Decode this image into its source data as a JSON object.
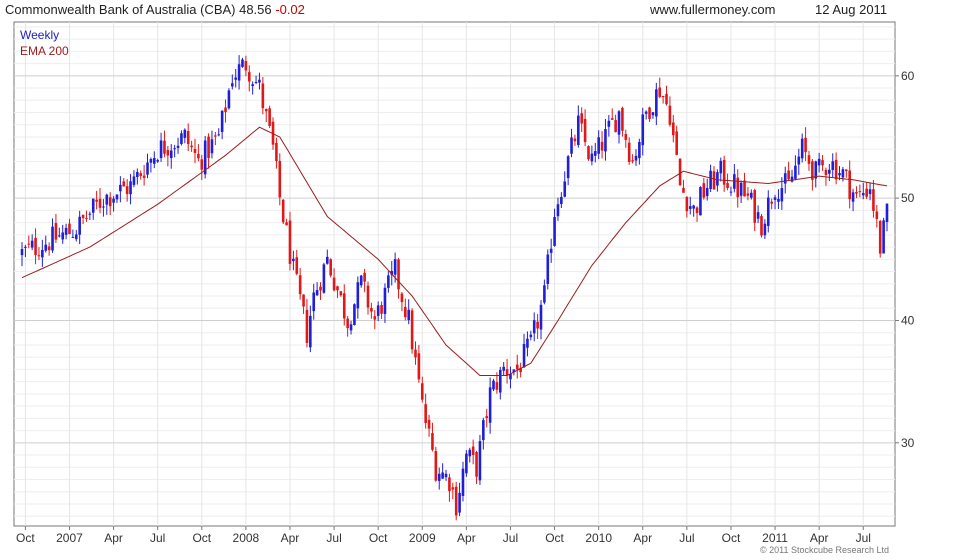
{
  "header": {
    "ticker": "Commonwealth Bank of Australia (CBA) 48.56",
    "change": "-0.02",
    "site": "www.fullermoney.com",
    "date": "12 Aug 2011"
  },
  "footer": {
    "copyright": "© 2011 Stockcube Research Ltd"
  },
  "colors": {
    "up": "#1f1fd6",
    "down": "#e01818",
    "ema": "#9b1c1c",
    "grid": "#d8d8d8",
    "axis": "#666666"
  },
  "chart_data": {
    "type": "candlestick",
    "frequency_label": "Weekly",
    "indicator_label": "EMA 200",
    "x_tick_labels": [
      "Oct",
      "2007",
      "Apr",
      "Jul",
      "Oct",
      "2008",
      "Apr",
      "Jul",
      "Oct",
      "2009",
      "Apr",
      "Jul",
      "Oct",
      "2010",
      "Apr",
      "Jul",
      "Oct",
      "2011",
      "Apr",
      "Jul"
    ],
    "y_ticks": [
      30,
      40,
      50,
      60
    ],
    "ylim": [
      23.2,
      64.4
    ],
    "xlim": [
      0,
      255
    ],
    "grid": true,
    "legend": "top-left",
    "price_anchors": [
      {
        "x": 0,
        "y": 45.5
      },
      {
        "x": 8,
        "y": 46.5
      },
      {
        "x": 16,
        "y": 47.5
      },
      {
        "x": 24,
        "y": 50
      },
      {
        "x": 32,
        "y": 51
      },
      {
        "x": 40,
        "y": 54
      },
      {
        "x": 48,
        "y": 55
      },
      {
        "x": 52,
        "y": 53
      },
      {
        "x": 58,
        "y": 55
      },
      {
        "x": 62,
        "y": 60
      },
      {
        "x": 66,
        "y": 61
      },
      {
        "x": 70,
        "y": 59
      },
      {
        "x": 74,
        "y": 54
      },
      {
        "x": 76,
        "y": 50
      },
      {
        "x": 80,
        "y": 44
      },
      {
        "x": 84,
        "y": 39
      },
      {
        "x": 86,
        "y": 42
      },
      {
        "x": 90,
        "y": 45
      },
      {
        "x": 96,
        "y": 40
      },
      {
        "x": 100,
        "y": 43
      },
      {
        "x": 104,
        "y": 40
      },
      {
        "x": 110,
        "y": 44
      },
      {
        "x": 114,
        "y": 40
      },
      {
        "x": 118,
        "y": 33
      },
      {
        "x": 122,
        "y": 28
      },
      {
        "x": 126,
        "y": 27
      },
      {
        "x": 128,
        "y": 25
      },
      {
        "x": 131,
        "y": 29
      },
      {
        "x": 134,
        "y": 28
      },
      {
        "x": 138,
        "y": 34
      },
      {
        "x": 142,
        "y": 36
      },
      {
        "x": 146,
        "y": 36
      },
      {
        "x": 150,
        "y": 38
      },
      {
        "x": 154,
        "y": 42
      },
      {
        "x": 157,
        "y": 49
      },
      {
        "x": 160,
        "y": 52
      },
      {
        "x": 164,
        "y": 56
      },
      {
        "x": 168,
        "y": 53
      },
      {
        "x": 172,
        "y": 55
      },
      {
        "x": 176,
        "y": 57
      },
      {
        "x": 180,
        "y": 53
      },
      {
        "x": 184,
        "y": 57
      },
      {
        "x": 188,
        "y": 59
      },
      {
        "x": 191,
        "y": 57
      },
      {
        "x": 194,
        "y": 51
      },
      {
        "x": 198,
        "y": 49
      },
      {
        "x": 202,
        "y": 51
      },
      {
        "x": 206,
        "y": 52
      },
      {
        "x": 210,
        "y": 51
      },
      {
        "x": 214,
        "y": 50
      },
      {
        "x": 218,
        "y": 48
      },
      {
        "x": 222,
        "y": 51
      },
      {
        "x": 226,
        "y": 51
      },
      {
        "x": 230,
        "y": 54
      },
      {
        "x": 234,
        "y": 52
      },
      {
        "x": 238,
        "y": 53
      },
      {
        "x": 242,
        "y": 52
      },
      {
        "x": 246,
        "y": 50
      },
      {
        "x": 250,
        "y": 51
      },
      {
        "x": 253,
        "y": 46
      },
      {
        "x": 255,
        "y": 48.6
      }
    ],
    "ema_anchors": [
      {
        "x": 0,
        "y": 43.5
      },
      {
        "x": 20,
        "y": 46
      },
      {
        "x": 40,
        "y": 49.5
      },
      {
        "x": 60,
        "y": 53.5
      },
      {
        "x": 70,
        "y": 55.8
      },
      {
        "x": 76,
        "y": 55
      },
      {
        "x": 90,
        "y": 48.5
      },
      {
        "x": 105,
        "y": 45
      },
      {
        "x": 115,
        "y": 42
      },
      {
        "x": 125,
        "y": 38
      },
      {
        "x": 135,
        "y": 35.5
      },
      {
        "x": 143,
        "y": 35.5
      },
      {
        "x": 150,
        "y": 36.5
      },
      {
        "x": 158,
        "y": 40
      },
      {
        "x": 168,
        "y": 44.5
      },
      {
        "x": 178,
        "y": 48
      },
      {
        "x": 188,
        "y": 51
      },
      {
        "x": 195,
        "y": 52.2
      },
      {
        "x": 205,
        "y": 51.5
      },
      {
        "x": 220,
        "y": 51.2
      },
      {
        "x": 235,
        "y": 51.8
      },
      {
        "x": 245,
        "y": 51.5
      },
      {
        "x": 255,
        "y": 51
      }
    ]
  }
}
